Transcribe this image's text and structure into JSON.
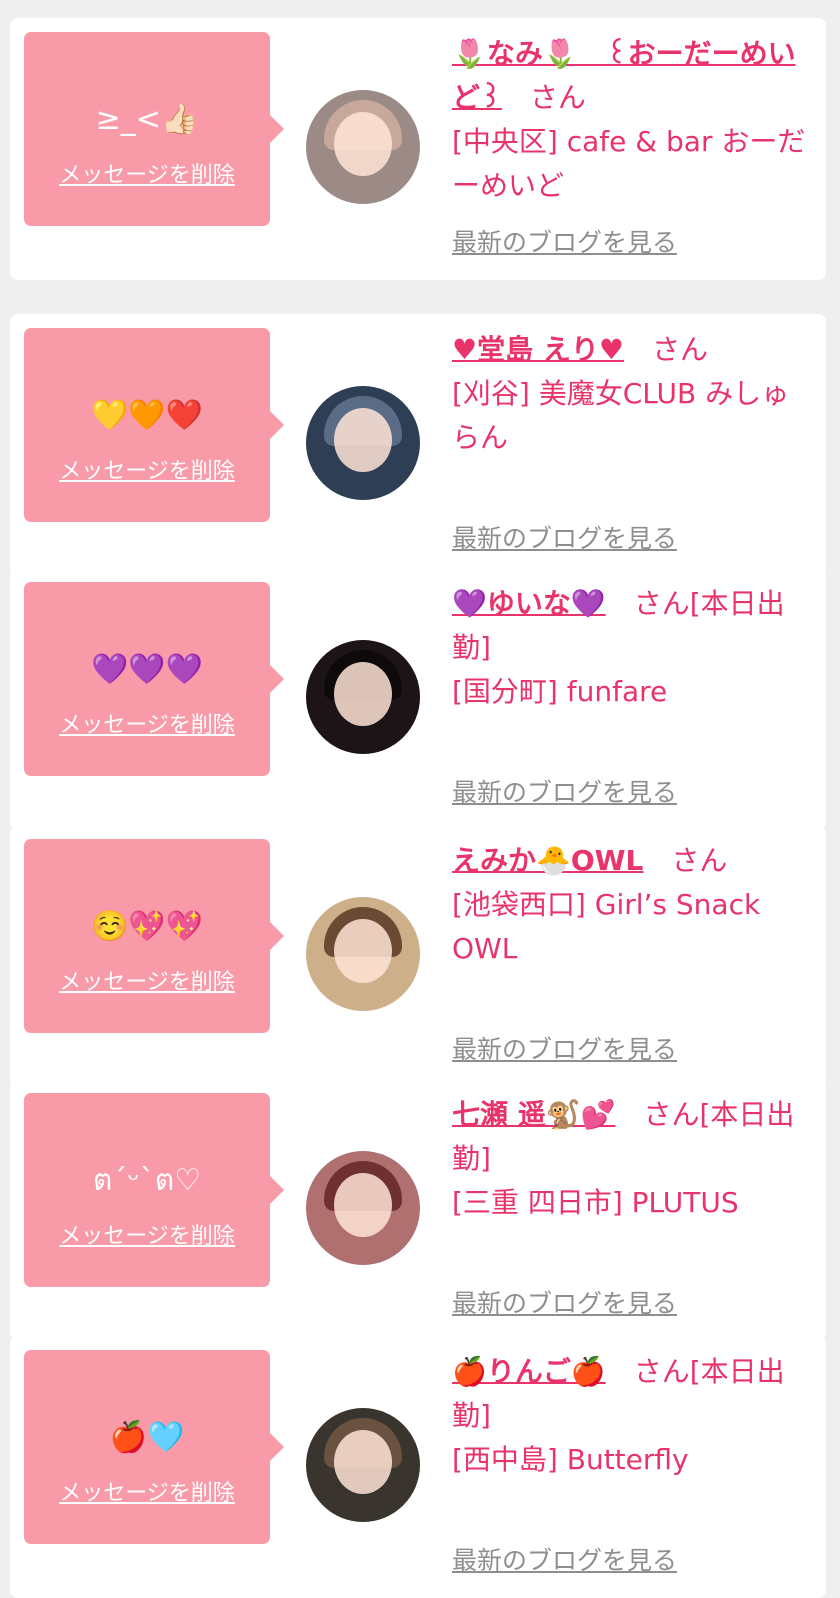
{
  "colors": {
    "page_background": "#efefef",
    "card_background": "#ffffff",
    "bubble": "#f99aa8",
    "accent_pink": "#e8336b",
    "link_gray": "#8e8e8e"
  },
  "entries": [
    {
      "message": "≥_<👍🏻",
      "delete_label": "メッセージを削除",
      "name": "🌷なみ🌷　꒰おーだーめいど꒱",
      "suffix": "さん",
      "shop": "[中央区] cafe & bar おーだーめいど",
      "blog_label": "最新のブログを見る",
      "avatar_bg": "#9c8a86",
      "avatar_hair": "#c8a89a"
    },
    {
      "message": "💛🧡❤️",
      "delete_label": "メッセージを削除",
      "name": "♥堂島 えり♥",
      "suffix": "さん",
      "shop": "[刈谷] 美魔女CLUB みしゅらん",
      "blog_label": "最新のブログを見る",
      "avatar_bg": "#2e3f55",
      "avatar_hair": "#5a6b86"
    },
    {
      "message": "💜💜💜",
      "delete_label": "メッセージを削除",
      "name": "💜ゆいな💜",
      "suffix": "さん[本日出勤]",
      "shop": "[国分町] funfare",
      "blog_label": "最新のブログを見る",
      "avatar_bg": "#1c1416",
      "avatar_hair": "#0e0a0c"
    },
    {
      "message": "☺️💖💖",
      "delete_label": "メッセージを削除",
      "name": "えみか🐣OWL",
      "suffix": "さん",
      "shop": "[池袋西口] Girl’s Snack OWL",
      "blog_label": "最新のブログを見る",
      "avatar_bg": "#cdb08a",
      "avatar_hair": "#6b4a34"
    },
    {
      "message": "ตˊᵕˋต♡",
      "delete_label": "メッセージを削除",
      "name": "七瀬 遥🐒💕",
      "suffix": "さん[本日出勤]",
      "shop": "[三重 四日市] PLUTUS",
      "blog_label": "最新のブログを見る",
      "avatar_bg": "#b07070",
      "avatar_hair": "#6e3030"
    },
    {
      "message": "🍎🩵",
      "delete_label": "メッセージを削除",
      "name": "🍎りんご🍎",
      "suffix": "さん[本日出勤]",
      "shop": "[西中島] Butterfly",
      "blog_label": "最新のブログを見る",
      "avatar_bg": "#3a342e",
      "avatar_hair": "#6a5240"
    }
  ]
}
